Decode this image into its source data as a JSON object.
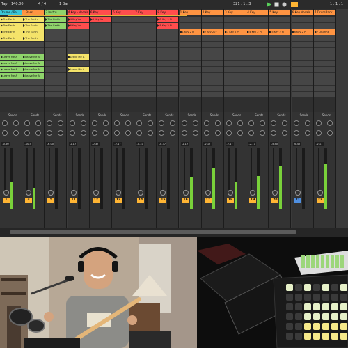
{
  "transport": {
    "tap_label": "Tap",
    "tempo": "140.00",
    "signature": "4 / 4",
    "quant": "1 Bar",
    "position": "321 . 1 . 3",
    "loop_end": "1 . 1 . 1",
    "accent": "#ffb534"
  },
  "colors": {
    "clip_orange": "#ff9442",
    "clip_red": "#ff4d4d",
    "clip_yellow": "#f4e36a",
    "clip_green": "#8fd46b",
    "meter": "#79d13a",
    "track_yellow": "#ffb534",
    "scene_highlight": "#e1b23b",
    "blue_scene": "#3d5ad6"
  },
  "tracks": [
    {
      "name": "Drums / Pe",
      "color": "#39c6d7",
      "send": "Sends",
      "vol": "-0.60",
      "pan": "-inf",
      "num": "1",
      "meter": 0.45
    },
    {
      "name": "1 Bass",
      "color": "#ff9442",
      "send": "Sends",
      "vol": "-10.5",
      "pan": "-inf",
      "num": "4",
      "meter": 0.35
    },
    {
      "name": "3 Instru",
      "color": "#8fd46b",
      "send": "Sends",
      "vol": "-6.00",
      "pan": "-inf",
      "num": "5",
      "meter": 0.0
    },
    {
      "name": "4 Key - Vocals",
      "color": "#ff4d4d",
      "send": "Sends",
      "vol": "-2.17",
      "pan": "-inf",
      "num": "11",
      "meter": 0.0
    },
    {
      "name": "6 Key",
      "color": "#ff4d4d",
      "send": "Sends",
      "vol": "-0.37",
      "pan": "-7.8",
      "num": "12",
      "meter": 0.0
    },
    {
      "name": "6 Key",
      "color": "#ff4d4d",
      "send": "Sends",
      "vol": "-2.17",
      "pan": "-inf",
      "num": "13",
      "meter": 0.0
    },
    {
      "name": "7 Key",
      "color": "#ff4d4d",
      "send": "Sends",
      "vol": "-0.37",
      "pan": "-inf",
      "num": "14",
      "meter": 0.0
    },
    {
      "name": "8 Key",
      "color": "#ff4d4d",
      "send": "Sends",
      "vol": "-0.37",
      "pan": "-inf",
      "num": "15",
      "meter": 0.0
    },
    {
      "name": "1 Key",
      "color": "#ff9442",
      "send": "Sends",
      "vol": "-2.17",
      "pan": "-inf",
      "num": "16",
      "meter": 0.52
    },
    {
      "name": "2 Key",
      "color": "#ff9442",
      "send": "Sends",
      "vol": "-2.17",
      "pan": "-inf",
      "num": "17",
      "meter": 0.68
    },
    {
      "name": "3 Key",
      "color": "#ff9442",
      "send": "Sends",
      "vol": "-2.17",
      "pan": "-inf",
      "num": "18",
      "meter": 0.46
    },
    {
      "name": "4 Key",
      "color": "#ff9442",
      "send": "Sends",
      "vol": "-2.17",
      "pan": "-inf",
      "num": "19",
      "meter": 0.55
    },
    {
      "name": "5 Key",
      "color": "#ff9442",
      "send": "Sends",
      "vol": "-5.40",
      "pan": "-inf",
      "num": "20",
      "meter": 0.72
    },
    {
      "name": "6 Key Vocals",
      "color": "#ff9442",
      "send": "Sends",
      "vol": "-6.42",
      "pan": "-inf",
      "num": "21",
      "meter": 0.0
    },
    {
      "name": "7 DrumRack",
      "color": "#ff9442",
      "send": "Sends",
      "vol": "-2.17",
      "pan": "-inf",
      "num": "22",
      "meter": 0.74
    }
  ],
  "clips": {
    "drums": [
      "The Earth",
      "The Earth",
      "The Earth",
      "The Earth",
      "",
      "",
      "Leave Me A",
      "Leave Me A",
      "Leave Me A",
      "Leave Me A"
    ],
    "bass": [
      "The Earth",
      "The Earth",
      "The Earth",
      "The Earth",
      "",
      "",
      "Leave Me A",
      "Leave Me A",
      "Leave Me A",
      "Leave Me A"
    ],
    "instru": [
      "The Earth",
      "The Earth",
      "",
      "",
      "",
      "",
      "",
      "",
      "",
      ""
    ],
    "key4": [
      "4 Key Vo",
      "6 Key Vo",
      "",
      "",
      "",
      "",
      "Leave Me A",
      "",
      "Leave Me A",
      ""
    ],
    "key6": [
      "6 Key Vo",
      "",
      "",
      "",
      "",
      "",
      "",
      "",
      "",
      ""
    ],
    "key8": [
      "8 Key 1 Pi",
      "8 Key 2 Pi",
      "",
      "",
      "",
      "",
      "",
      "",
      "",
      ""
    ],
    "orange_row": [
      "1 Key 2 Pi",
      "2 Key 207",
      "3 Key 2 Pi",
      "4 Key 2 Pi",
      "5 Key 2 Pi",
      "6 Key 2 Pi",
      "7 DrumRk"
    ]
  }
}
